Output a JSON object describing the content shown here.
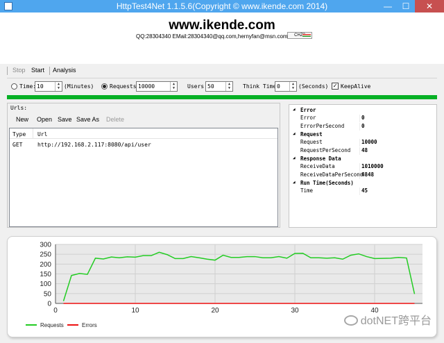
{
  "window": {
    "title": "HttpTest4Net 1.1.5.6(Copyright © www.ikende.com  2014)"
  },
  "header": {
    "site": "www.ikende.com",
    "contact": "QQ:28304340 EMail:28304340@qq.com,hernyfan@msn.com",
    "lang_badge": "CHZ2"
  },
  "menu": {
    "stop": "Stop",
    "start": "Start",
    "analysis": "Analysis"
  },
  "params": {
    "time_label": "Time:",
    "time_value": "10",
    "time_unit": "(Minutes)",
    "requests_label": "Requests:",
    "requests_value": "10000",
    "users_label": "Users:",
    "users_value": "50",
    "think_label": "Think Time:",
    "think_value": "0",
    "think_unit": "(Seconds)",
    "keepalive_label": "KeepAlive",
    "selected_mode": "requests",
    "progress_fraction": 1.0
  },
  "urls": {
    "caption": "Urls:",
    "toolbar": {
      "new": "New",
      "open": "Open",
      "save": "Save",
      "save_as": "Save As",
      "delete": "Delete"
    },
    "columns": [
      "Type",
      "Url"
    ],
    "rows": [
      {
        "type": "GET",
        "url": "http://192.168.2.117:8080/api/user"
      }
    ]
  },
  "stats": [
    {
      "name": "Error",
      "props": [
        {
          "k": "Error",
          "v": "0"
        },
        {
          "k": "ErrorPerSecond",
          "v": "0"
        }
      ]
    },
    {
      "name": "Request",
      "props": [
        {
          "k": "Request",
          "v": "10000"
        },
        {
          "k": "RequestPerSecond",
          "v": "48"
        }
      ]
    },
    {
      "name": "Response Data",
      "props": [
        {
          "k": "ReceiveData",
          "v": "1010000"
        },
        {
          "k": "ReceiveDataPerSecond",
          "v": "4848"
        }
      ]
    },
    {
      "name": "Run Time(Seconds)",
      "props": [
        {
          "k": "Time",
          "v": "45"
        }
      ]
    }
  ],
  "chart_data": {
    "type": "line",
    "title": "",
    "xlabel": "",
    "ylabel": "",
    "xlim": [
      0,
      46
    ],
    "ylim": [
      0,
      300
    ],
    "xticks": [
      0,
      10,
      20,
      30,
      40
    ],
    "yticks": [
      0,
      50,
      100,
      150,
      200,
      250,
      300
    ],
    "grid": true,
    "legend": "bottom-left",
    "series": [
      {
        "name": "Requests",
        "color": "#22cc22",
        "x": [
          1,
          2,
          3,
          4,
          5,
          6,
          7,
          8,
          9,
          10,
          11,
          12,
          13,
          14,
          15,
          16,
          17,
          18,
          19,
          20,
          21,
          22,
          23,
          24,
          25,
          26,
          27,
          28,
          29,
          30,
          31,
          32,
          33,
          34,
          35,
          36,
          37,
          38,
          39,
          40,
          41,
          42,
          43,
          44,
          45
        ],
        "y": [
          12,
          142,
          152,
          148,
          230,
          226,
          236,
          232,
          237,
          235,
          243,
          243,
          260,
          248,
          228,
          228,
          238,
          232,
          225,
          220,
          245,
          234,
          234,
          238,
          238,
          232,
          232,
          238,
          230,
          254,
          255,
          232,
          232,
          230,
          232,
          225,
          245,
          252,
          238,
          228,
          229,
          230,
          234,
          231,
          48
        ]
      },
      {
        "name": "Errors",
        "color": "#ee1111",
        "x": [
          1,
          45
        ],
        "y": [
          0,
          0
        ]
      }
    ]
  },
  "watermark": "dotNET跨平台"
}
